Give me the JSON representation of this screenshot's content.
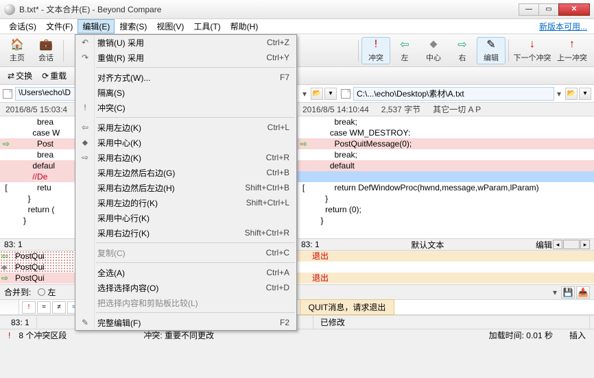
{
  "title": "B.txt* - 文本合并(E) - Beyond Compare",
  "newver": "新版本可用...",
  "menu": {
    "session": "会话(S)",
    "file": "文件(F)",
    "edit": "编辑(E)",
    "search": "搜索(S)",
    "view": "视图(V)",
    "tools": "工具(T)",
    "help": "帮助(H)"
  },
  "toolbar": {
    "home": "主页",
    "sessions": "会话",
    "conflict": "冲突",
    "left": "左",
    "center": "中心",
    "right": "右",
    "edit": "编辑",
    "nextc": "下一个冲突",
    "prevc": "上一冲突"
  },
  "toolbar2": {
    "swap": "交换",
    "reload": "重载"
  },
  "paths": {
    "left": "\\Users\\echo\\D",
    "right": "C:\\...\\echo\\Desktop\\素材\\A.txt"
  },
  "info": {
    "left": {
      "time": "2016/8/5 15:03:4",
      "extra": ""
    },
    "right": {
      "time": "2016/8/5 14:10:44",
      "bytes": "2,537 字节",
      "rest": "其它一切  A  P"
    }
  },
  "code_left": {
    "l1": "      brea",
    "l2": "    case W",
    "l3": "      Post",
    "l4": "      brea",
    "l5": "    defaul",
    "l6": "    //De",
    "l7": "      retu",
    "l8": "  }",
    "l9": "  return (",
    "l10": "}"
  },
  "code_right": {
    "l1": "      break;",
    "l2": "    case WM_DESTROY:",
    "l3": "      PostQuitMessage(0);",
    "l4": "      break;",
    "l5": "    default",
    "l6": "",
    "l7": "      return DefWindowProc(hwnd,message,wParam,lParam)",
    "l8": "  }",
    "l9": "  return (0);",
    "l10": "}"
  },
  "pos": {
    "left": "83: 1",
    "right": "83: 1",
    "label": "默认文本",
    "editbtn": "编辑"
  },
  "merge": {
    "l1": "PostQui",
    "l2": "PostQui",
    "l3": "PostQui",
    "r1": "退出",
    "r2": "退出"
  },
  "mergebar": {
    "to": "合并到:",
    "left": "左",
    "save": "💾",
    "load": "📥"
  },
  "output_msg": "QUIT消息，请求退出",
  "status1": {
    "pos": "83: 1",
    "enc": "默认文本",
    "mod": "已修改"
  },
  "status2": {
    "conflicts": "8 个冲突区段",
    "conflict_label": "冲突: 重要不同更改",
    "load": "加载时间: 0.01 秒",
    "ins": "插入"
  },
  "dropdown": {
    "items": [
      {
        "icon": "↶",
        "label": "撤销(U) 采用",
        "shortcut": "Ctrl+Z",
        "sep": false
      },
      {
        "icon": "↷",
        "label": "重做(R) 采用",
        "shortcut": "Ctrl+Y",
        "sep": false
      },
      {
        "sep": true
      },
      {
        "icon": "",
        "label": "对齐方式(W)...",
        "shortcut": "F7",
        "sep": false
      },
      {
        "icon": "",
        "label": "隔离(S)",
        "shortcut": "",
        "sep": false
      },
      {
        "icon": "!",
        "label": "冲突(C)",
        "shortcut": "",
        "sep": false
      },
      {
        "sep": true
      },
      {
        "icon": "⇦",
        "label": "采用左边(K)",
        "shortcut": "Ctrl+L",
        "sep": false
      },
      {
        "icon": "⬥",
        "label": "采用中心(K)",
        "shortcut": "",
        "sep": false
      },
      {
        "icon": "⇨",
        "label": "采用右边(K)",
        "shortcut": "Ctrl+R",
        "sep": false
      },
      {
        "icon": "",
        "label": "采用左边然后右边(G)",
        "shortcut": "Ctrl+B",
        "sep": false
      },
      {
        "icon": "",
        "label": "采用右边然后左边(H)",
        "shortcut": "Shift+Ctrl+B",
        "sep": false
      },
      {
        "icon": "",
        "label": "采用左边的行(K)",
        "shortcut": "Shift+Ctrl+L",
        "sep": false
      },
      {
        "icon": "",
        "label": "采用中心行(K)",
        "shortcut": "",
        "sep": false
      },
      {
        "icon": "",
        "label": "采用右边行(K)",
        "shortcut": "Shift+Ctrl+R",
        "sep": false
      },
      {
        "sep": true
      },
      {
        "icon": "",
        "label": "复制(C)",
        "shortcut": "Ctrl+C",
        "sep": false,
        "dis": true
      },
      {
        "sep": true
      },
      {
        "icon": "",
        "label": "全选(A)",
        "shortcut": "Ctrl+A",
        "sep": false
      },
      {
        "icon": "",
        "label": "选择选择内容(O)",
        "shortcut": "Ctrl+D",
        "sep": false
      },
      {
        "icon": "",
        "label": "把选择内容和剪贴板比较(L)",
        "shortcut": "",
        "sep": false,
        "dis": true
      },
      {
        "sep": true
      },
      {
        "icon": "✎",
        "label": "完整编辑(F)",
        "shortcut": "F2",
        "sep": false
      }
    ]
  }
}
